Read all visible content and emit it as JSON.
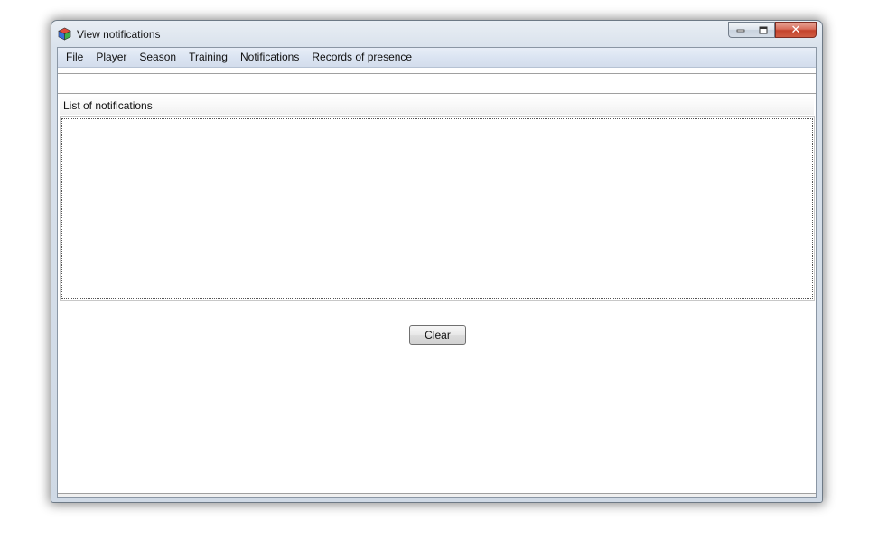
{
  "window": {
    "title": "View notifications",
    "icon": "app-cube-icon",
    "caption_buttons": {
      "minimize_icon": "minimize-icon",
      "maximize_icon": "maximize-icon",
      "close_icon": "close-icon",
      "close_glyph": "✕"
    }
  },
  "menubar": {
    "items": [
      {
        "label": "File"
      },
      {
        "label": "Player"
      },
      {
        "label": "Season"
      },
      {
        "label": "Training"
      },
      {
        "label": "Notifications"
      },
      {
        "label": "Records of presence"
      }
    ]
  },
  "notifications": {
    "header": "List of notifications",
    "items": []
  },
  "actions": {
    "clear_label": "Clear"
  },
  "colors": {
    "menubar": "#dbe4f2",
    "close_button": "#c4432c",
    "window_frame": "#cfd9e5"
  }
}
